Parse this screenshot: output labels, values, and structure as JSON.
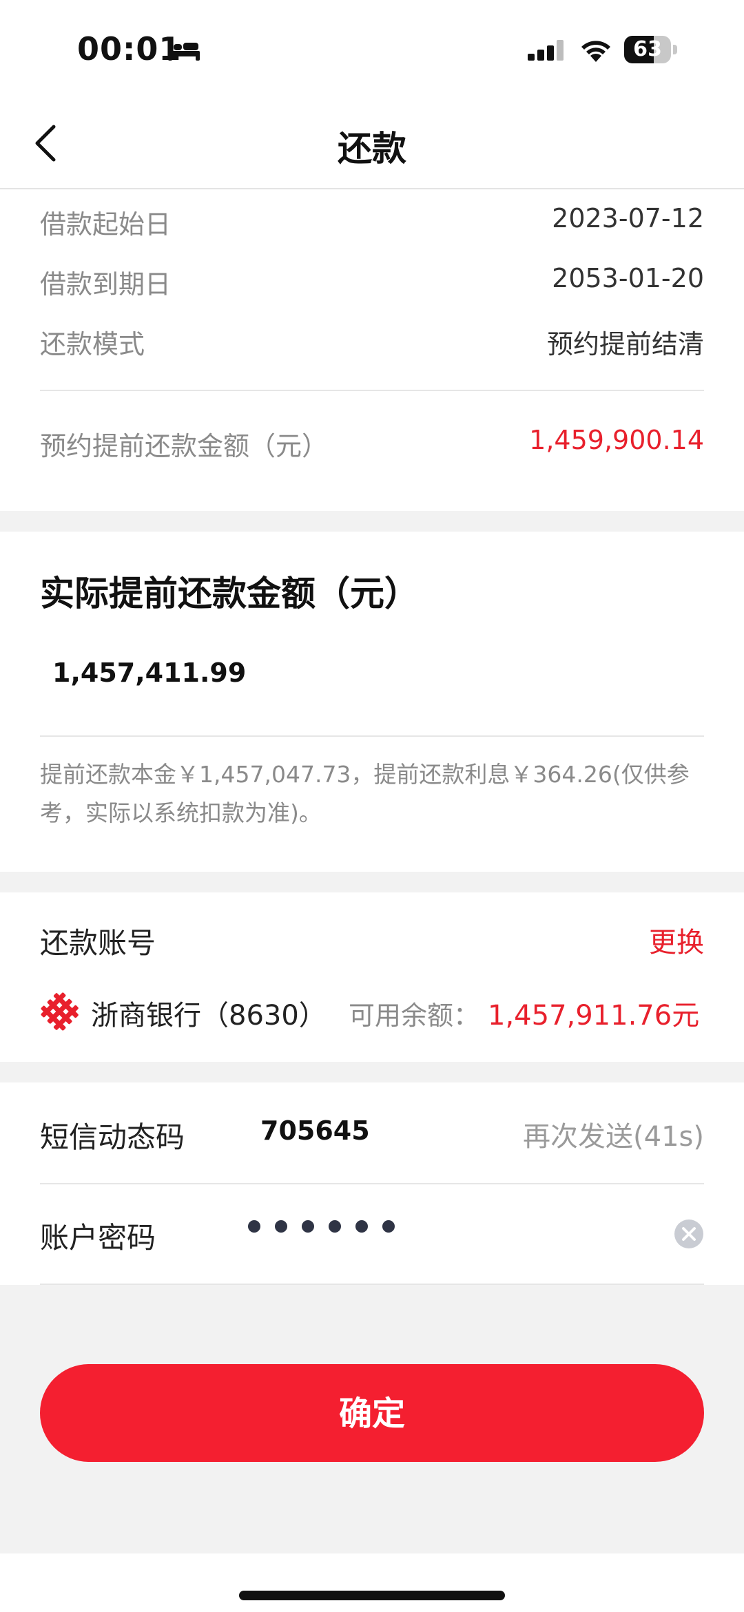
{
  "status_bar": {
    "time": "00:01",
    "battery_level": "63",
    "battery_fraction": 0.63,
    "icons": [
      "bed-icon",
      "cellular-signal-icon",
      "wifi-icon",
      "battery-icon"
    ]
  },
  "nav": {
    "title": "还款",
    "back_icon": "chevron-left-icon"
  },
  "loan_info": {
    "rows": [
      {
        "label": "借款起始日",
        "value": "2023-07-12"
      },
      {
        "label": "借款到期日",
        "value": "2053-01-20"
      },
      {
        "label": "还款模式",
        "value": "预约提前结清"
      }
    ],
    "scheduled_label": "预约提前还款金额（元）",
    "scheduled_value": "1,459,900.14"
  },
  "actual_repayment": {
    "title": "实际提前还款金额（元）",
    "amount_value": "1,457,411.99",
    "note": "提前还款本金￥1,457,047.73，提前还款利息￥364.26(仅供参考，实际以系统扣款为准)。"
  },
  "account": {
    "title": "还款账号",
    "change_label": "更换",
    "bank_name": "浙商银行（8630）",
    "balance_label": "可用余额：",
    "balance_value": "1,457,911.76元",
    "bank_icon": "bank-logo-icon"
  },
  "verification": {
    "sms_label": "短信动态码",
    "sms_value": "705645",
    "resend_label": "再次发送(41s)",
    "password_label": "账户密码",
    "password_length": 6,
    "clear_icon": "clear-icon"
  },
  "confirm_label": "确定",
  "colors": {
    "accent_red": "#e8202c",
    "button_red": "#f41f30",
    "muted_text": "#8a8a8a",
    "background": "#f2f2f2"
  }
}
